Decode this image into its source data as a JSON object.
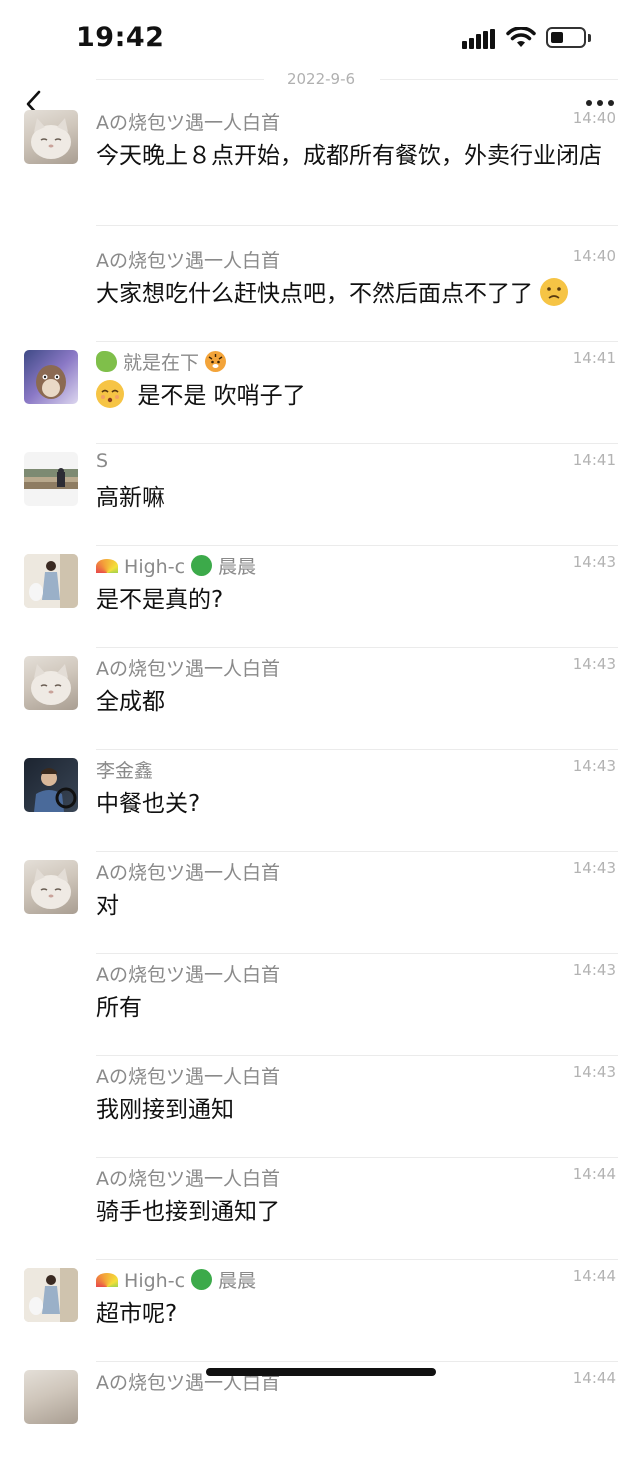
{
  "status_bar": {
    "time": "19:42"
  },
  "chat": {
    "date_divider": "2022-9-6",
    "messages": [
      {
        "sender": "Aの烧包ツ遇一人白首",
        "time": "14:40",
        "text": "今天晚上８点开始，成都所有餐饮，外卖行业闭店",
        "avatar": "cat-avatar",
        "show_avatar": true
      },
      {
        "sender": "Aの烧包ツ遇一人白首",
        "time": "14:40",
        "text": "大家想吃什么赶快点吧，不然后面点不了了",
        "avatar": "",
        "show_avatar": false,
        "trailing_emoji": "confused-face-emoji"
      },
      {
        "sender_prefix_emoji": "dragon-emoji",
        "sender": "就是在下",
        "sender_suffix_emoji": "tiger-face-emoji",
        "time": "14:41",
        "leading_emoji": "whistling-face-emoji",
        "text": "是不是 吹哨子了",
        "avatar": "cartoon-avatar",
        "show_avatar": true
      },
      {
        "sender": "S",
        "time": "14:41",
        "text": "高新嘛",
        "avatar": "photo-avatar",
        "show_avatar": true
      },
      {
        "sender_prefix_emoji": "rainbow-emoji",
        "sender": "High-c",
        "sender_mid_emoji": "four-leaf-clover-emoji",
        "sender_suffix": "晨晨",
        "time": "14:43",
        "text": "是不是真的?",
        "avatar": "girl-photo-avatar",
        "show_avatar": true
      },
      {
        "sender": "Aの烧包ツ遇一人白首",
        "time": "14:43",
        "text": "全成都",
        "avatar": "cat-avatar",
        "show_avatar": true
      },
      {
        "sender": "李金鑫",
        "time": "14:43",
        "text": "中餐也关?",
        "avatar": "driver-photo-avatar",
        "show_avatar": true
      },
      {
        "sender": "Aの烧包ツ遇一人白首",
        "time": "14:43",
        "text": "对",
        "avatar": "cat-avatar",
        "show_avatar": true
      },
      {
        "sender": "Aの烧包ツ遇一人白首",
        "time": "14:43",
        "text": "所有",
        "avatar": "",
        "show_avatar": false
      },
      {
        "sender": "Aの烧包ツ遇一人白首",
        "time": "14:43",
        "text": "我刚接到通知",
        "avatar": "",
        "show_avatar": false
      },
      {
        "sender": "Aの烧包ツ遇一人白首",
        "time": "14:44",
        "text": "骑手也接到通知了",
        "avatar": "",
        "show_avatar": false
      },
      {
        "sender_prefix_emoji": "rainbow-emoji",
        "sender": "High-c",
        "sender_mid_emoji": "four-leaf-clover-emoji",
        "sender_suffix": "晨晨",
        "time": "14:44",
        "text": "超市呢?",
        "avatar": "girl-photo-avatar",
        "show_avatar": true
      },
      {
        "sender": "Aの烧包ツ遇一人白首",
        "time": "14:44",
        "text": "",
        "avatar": "cat-avatar",
        "show_avatar": true
      }
    ]
  },
  "icons": {
    "back": "chevron-left-icon",
    "more": "more-dots-icon",
    "signal": "cellular-signal-icon",
    "wifi": "wifi-icon",
    "battery": "battery-icon"
  },
  "colors": {
    "sender_name": "#8a8a8a",
    "timestamp": "#b3b3b3",
    "separator": "#ebebeb",
    "message_text": "#111111"
  }
}
